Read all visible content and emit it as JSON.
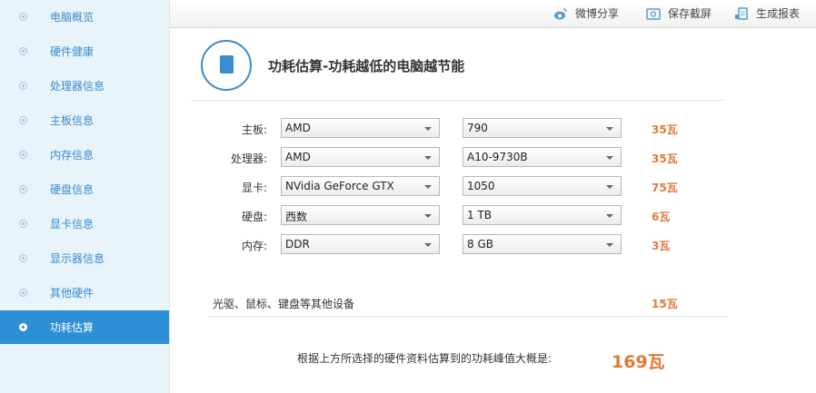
{
  "sidebar": {
    "items": [
      {
        "label": "电脑概览"
      },
      {
        "label": "硬件健康"
      },
      {
        "label": "处理器信息"
      },
      {
        "label": "主板信息"
      },
      {
        "label": "内存信息"
      },
      {
        "label": "硬盘信息"
      },
      {
        "label": "显卡信息"
      },
      {
        "label": "显示器信息"
      },
      {
        "label": "其他硬件"
      },
      {
        "label": "功耗估算"
      }
    ],
    "active": 9
  },
  "header": {
    "weibo": "微博分享",
    "screenshot": "保存截屏",
    "report": "生成报表"
  },
  "main": {
    "title": "功耗估算-功耗越低的电脑越节能",
    "rows": [
      {
        "label": "主板:",
        "brand": "AMD",
        "model": "790",
        "watt": "35瓦"
      },
      {
        "label": "处理器:",
        "brand": "AMD",
        "model": "A10-9730B",
        "watt": "35瓦"
      },
      {
        "label": "显卡:",
        "brand": "NVidia GeForce GTX",
        "model": "1050",
        "watt": "75瓦"
      },
      {
        "label": "硬盘:",
        "brand": "西数",
        "model": "1 TB",
        "watt": "6瓦"
      },
      {
        "label": "内存:",
        "brand": "DDR",
        "model": "8 GB",
        "watt": "3瓦"
      }
    ],
    "extra_label": "光驱、鼠标、键盘等其他设备",
    "extra_watt": "15瓦",
    "total_label": "根据上方所选择的硬件资料估算到的功耗峰值大概是:",
    "total_watt": "169瓦"
  },
  "colors": {
    "accent": "#2d8fd5",
    "watt": "#e07a3a"
  }
}
